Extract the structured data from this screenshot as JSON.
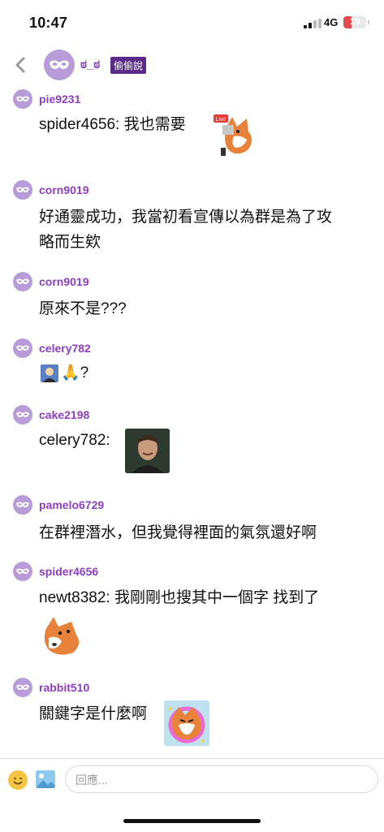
{
  "status": {
    "time": "10:47",
    "network": "4G",
    "battery": "19"
  },
  "header": {
    "title": "ಠ_ಠ",
    "badge": "偷偷說"
  },
  "messages": [
    {
      "user": "pie9231",
      "text": "spider4656: 我也需要",
      "sticker": "fox-live-sticker"
    },
    {
      "user": "corn9019",
      "lines": [
        "好通靈成功，我當初看宣傳以為群是為了攻",
        "略而生欸"
      ]
    },
    {
      "user": "corn9019",
      "text": "原來不是???"
    },
    {
      "user": "celery782",
      "text": "🙏?"
    },
    {
      "user": "cake2198",
      "text": "celery782:",
      "sticker": "photo-man-smiling"
    },
    {
      "user": "pamelo6729",
      "text": "在群裡潛水，但我覺得裡面的氣氛還好啊"
    },
    {
      "user": "spider4656",
      "text": "newt8382: 我剛剛也搜其中一個字 找到了",
      "sticker": "fox-shocked-sticker"
    },
    {
      "user": "rabbit510",
      "text": "關鍵字是什麼啊",
      "sticker": "fox-sparkle-sticker"
    }
  ],
  "composer": {
    "placeholder": "回應..."
  }
}
